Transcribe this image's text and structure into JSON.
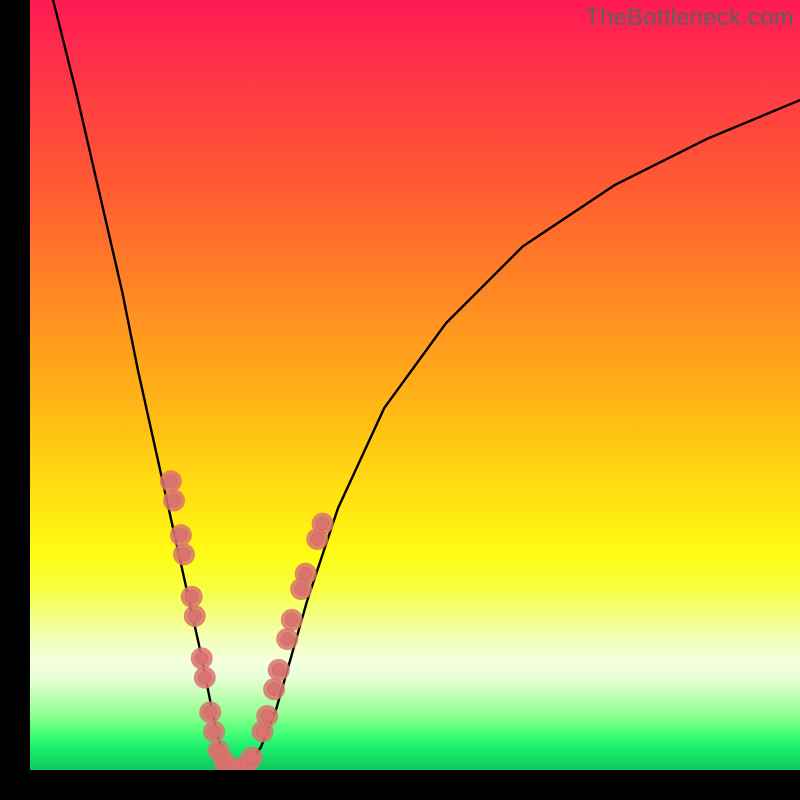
{
  "watermark": "TheBottleneck.com",
  "colors": {
    "frame": "#000000",
    "curve": "#000000",
    "marker_fill": "#d9736f",
    "marker_stroke": "#c56560",
    "watermark": "#5f5f5f"
  },
  "chart_data": {
    "type": "line",
    "title": "",
    "xlabel": "",
    "ylabel": "",
    "xlim": [
      0,
      100
    ],
    "ylim": [
      0,
      100
    ],
    "grid": false,
    "legend_position": "none",
    "annotations": [
      "TheBottleneck.com"
    ],
    "series": [
      {
        "name": "bottleneck-curve",
        "x": [
          3,
          6,
          9,
          12,
          14,
          16,
          18,
          20,
          22,
          23,
          24,
          25,
          26,
          27,
          28,
          30,
          32,
          34,
          36,
          40,
          46,
          54,
          64,
          76,
          88,
          100
        ],
        "y": [
          100,
          88,
          75,
          62,
          52,
          43,
          34,
          25,
          16,
          11,
          6,
          2,
          0,
          0,
          0,
          3,
          8,
          15,
          22,
          34,
          47,
          58,
          68,
          76,
          82,
          87
        ]
      }
    ],
    "markers": [
      {
        "name": "left-branch-markers",
        "points": [
          {
            "x": 18.3,
            "y": 37.5
          },
          {
            "x": 18.7,
            "y": 35.0
          },
          {
            "x": 19.6,
            "y": 30.5
          },
          {
            "x": 20.0,
            "y": 28.0
          },
          {
            "x": 21.0,
            "y": 22.5
          },
          {
            "x": 21.4,
            "y": 20.0
          },
          {
            "x": 22.3,
            "y": 14.5
          },
          {
            "x": 22.7,
            "y": 12.0
          },
          {
            "x": 23.4,
            "y": 7.5
          },
          {
            "x": 23.9,
            "y": 5.0
          },
          {
            "x": 24.5,
            "y": 2.5
          },
          {
            "x": 25.3,
            "y": 1.0
          }
        ]
      },
      {
        "name": "trough-markers",
        "points": [
          {
            "x": 26.0,
            "y": 0.2
          },
          {
            "x": 26.7,
            "y": 0.0
          },
          {
            "x": 27.4,
            "y": 0.1
          },
          {
            "x": 28.1,
            "y": 0.6
          },
          {
            "x": 28.8,
            "y": 1.6
          }
        ]
      },
      {
        "name": "right-branch-markers",
        "points": [
          {
            "x": 30.2,
            "y": 5.0
          },
          {
            "x": 30.8,
            "y": 7.0
          },
          {
            "x": 31.7,
            "y": 10.5
          },
          {
            "x": 32.3,
            "y": 13.0
          },
          {
            "x": 33.4,
            "y": 17.0
          },
          {
            "x": 34.0,
            "y": 19.5
          },
          {
            "x": 35.2,
            "y": 23.5
          },
          {
            "x": 35.8,
            "y": 25.5
          },
          {
            "x": 37.3,
            "y": 30.0
          },
          {
            "x": 38.0,
            "y": 32.0
          }
        ]
      }
    ]
  }
}
